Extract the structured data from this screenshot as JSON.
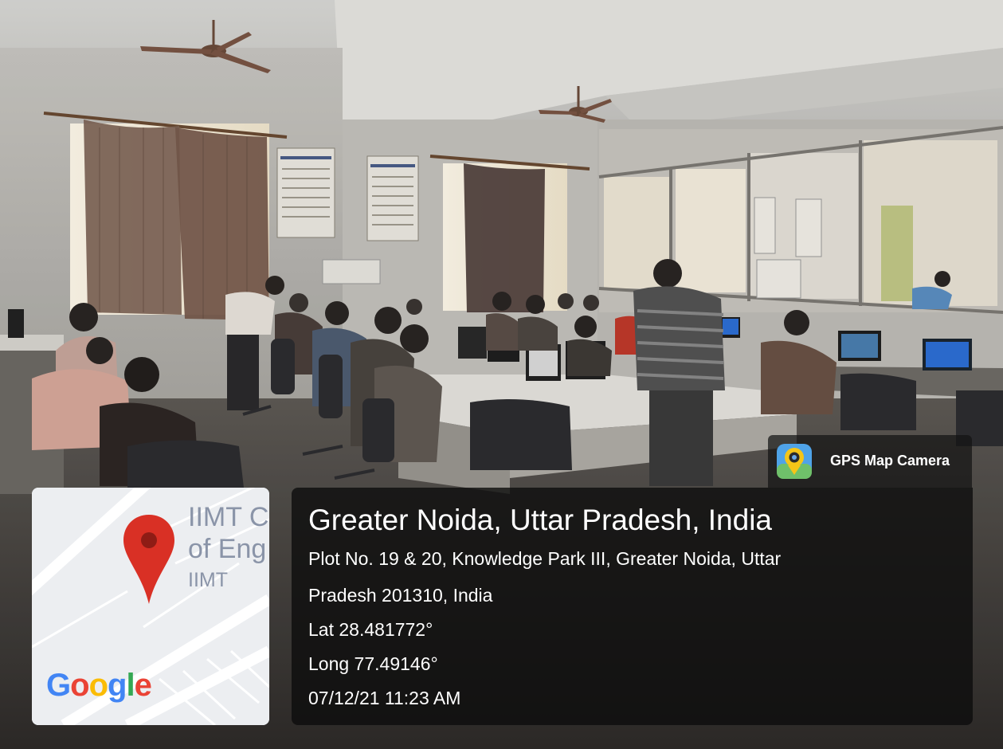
{
  "photo": {
    "subject": "computer lab classroom with students at desktop computers",
    "icons": [
      "ceiling-fan-icon",
      "ceiling-fan-icon"
    ]
  },
  "badge": {
    "label": "GPS Map Camera",
    "icon": "gps-map-camera-icon"
  },
  "map": {
    "labels": [
      "IIMT C",
      "of Eng",
      "IIMT"
    ],
    "logo": "Google",
    "pin_color": "#d93025",
    "background_color": "#eceef1"
  },
  "location": {
    "title": "Greater Noida, Uttar Pradesh, India",
    "address_line1": "Plot No. 19 & 20, Knowledge Park III, Greater Noida, Uttar",
    "address_line2": "Pradesh 201310, India",
    "latitude": "Lat 28.481772°",
    "longitude": "Long 77.49146°",
    "timestamp": "07/12/21 11:23 AM"
  }
}
